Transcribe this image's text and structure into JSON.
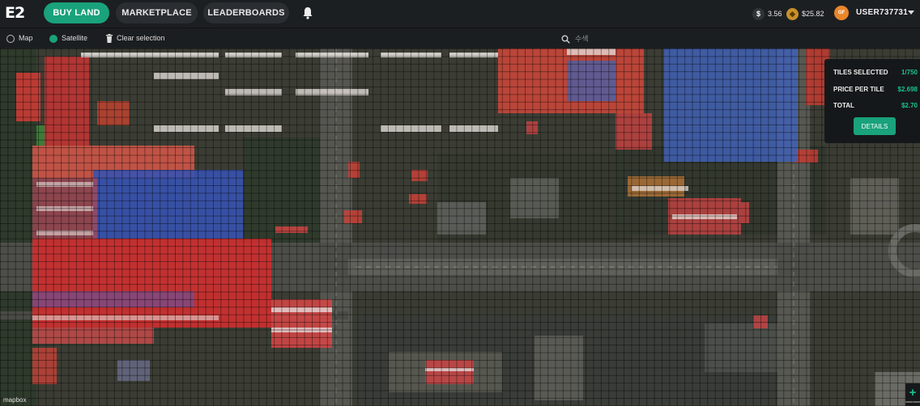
{
  "header": {
    "logo": "E2",
    "tabs": [
      {
        "label": "BUY LAND",
        "active": true
      },
      {
        "label": "MARKETPLACE",
        "active": false
      },
      {
        "label": "LEADERBOARDS",
        "active": false
      }
    ],
    "balances": {
      "dollar_value": "3.56",
      "essence_value": "$25.82"
    },
    "avatar_initials": "GF",
    "username": "USER737731"
  },
  "toolbar": {
    "map_label": "Map",
    "satellite_label": "Satellite",
    "selected_view": "Satellite",
    "clear_label": "Clear selection",
    "search_placeholder": "수색"
  },
  "panel": {
    "tiles_selected_label": "TILES SELECTED",
    "tiles_selected_value": "1/750",
    "price_per_tile_label": "PRICE PER TILE",
    "price_per_tile_value": "$2.698",
    "total_label": "TOTAL",
    "total_value": "$2.70",
    "details_label": "DETAILS"
  },
  "map": {
    "attribution": "mapbox",
    "zoom_in": "+",
    "zoom_out": "−"
  },
  "colors": {
    "accent": "#19a27b",
    "owned_red": "#d23c36",
    "owned_blue": "#3a55b8"
  },
  "icons": [
    "bell-icon",
    "dollar-coin-icon",
    "essence-coin-icon",
    "trash-icon",
    "search-icon",
    "caret-down-icon"
  ]
}
